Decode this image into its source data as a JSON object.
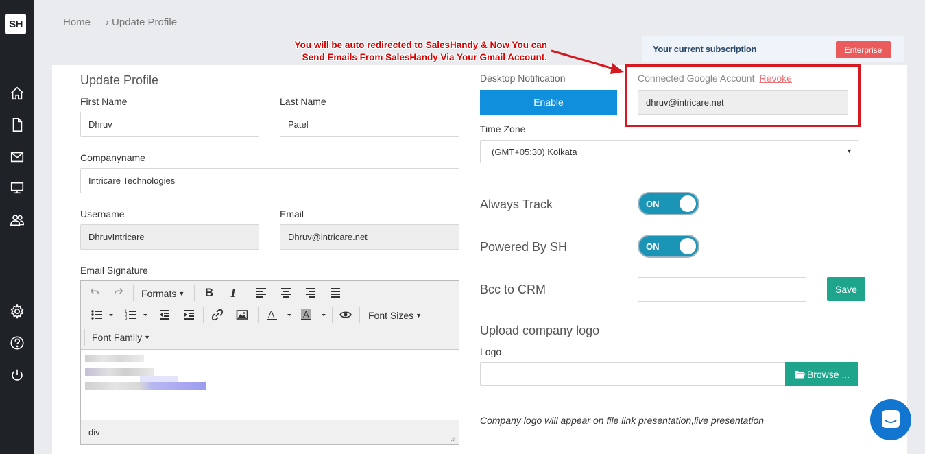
{
  "sidebar": {
    "logo": "SH",
    "items": [
      {
        "icon": "home-icon"
      },
      {
        "icon": "document-icon"
      },
      {
        "icon": "mail-icon"
      },
      {
        "icon": "monitor-icon"
      },
      {
        "icon": "users-icon"
      },
      {
        "icon": "gear-icon"
      },
      {
        "icon": "help-icon"
      },
      {
        "icon": "power-icon"
      }
    ]
  },
  "breadcrumb": {
    "home": "Home",
    "current": "Update Profile",
    "separator": ">"
  },
  "callout": {
    "line1": "You will be auto redirected to SalesHandy & Now You can",
    "line2": "Send Emails From SalesHandy Via Your Gmail Account.",
    "color": "#d60000"
  },
  "subscription": {
    "label": "Your current subscription",
    "plan": "Enterprise"
  },
  "profile": {
    "title": "Update Profile",
    "first_name_label": "First Name",
    "first_name": "Dhruv",
    "last_name_label": "Last Name",
    "last_name": "Patel",
    "company_label": "Companyname",
    "company": "Intricare Technologies",
    "username_label": "Username",
    "username": "DhruvIntricare",
    "email_label": "Email",
    "email": "Dhruv@intricare.net",
    "signature_label": "Email Signature"
  },
  "editor": {
    "formats": "Formats",
    "font_sizes": "Font Sizes",
    "font_family": "Font Family",
    "status_path": "div"
  },
  "settings": {
    "desktop_notification_label": "Desktop Notification",
    "enable_button": "Enable",
    "google_account_label": "Connected Google Account",
    "revoke": "Revoke",
    "google_account": "dhruv@intricare.net",
    "timezone_label": "Time Zone",
    "timezone": "(GMT+05:30) Kolkata",
    "always_track_label": "Always Track",
    "always_track_value": "ON",
    "powered_by_label": "Powered By SH",
    "powered_by_value": "ON",
    "bcc_label": "Bcc to CRM",
    "bcc_value": "",
    "save_button": "Save",
    "upload_logo_title": "Upload company logo",
    "logo_label": "Logo",
    "browse_button": "Browse ...",
    "logo_note": "Company logo will appear on file link presentation,live presentation"
  },
  "colors": {
    "sidebar": "#1f2328",
    "enable": "#0f8fdc",
    "toggle": "#1a95b6",
    "save": "#20a58d",
    "enterprise_badge": "#ec5b5b",
    "highlight_box": "#d41920"
  }
}
